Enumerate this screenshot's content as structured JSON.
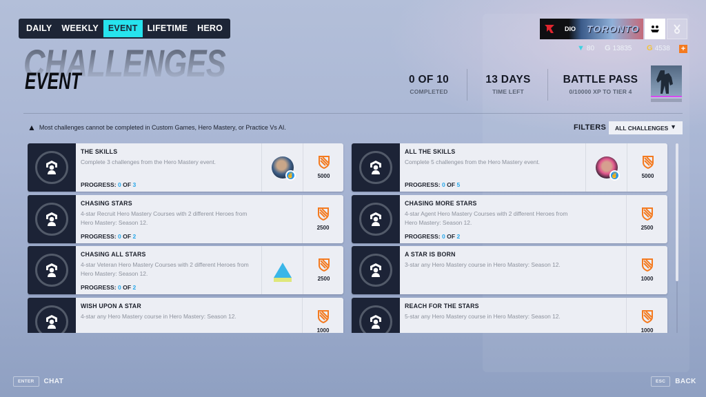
{
  "tabs": [
    {
      "label": "DAILY",
      "active": false
    },
    {
      "label": "WEEKLY",
      "active": false
    },
    {
      "label": "EVENT",
      "active": true
    },
    {
      "label": "LIFETIME",
      "active": false
    },
    {
      "label": "HERO",
      "active": false
    }
  ],
  "header": {
    "title": "CHALLENGES",
    "subtitle": "EVENT"
  },
  "player": {
    "name": "DIO",
    "banner_text": "TORONTO",
    "logo_glyph": "⊿"
  },
  "currencies": [
    {
      "icon": "legacy-credits-icon",
      "glyph": "▼",
      "value": "80",
      "color": "#3fd2e0"
    },
    {
      "icon": "competitive-points-icon",
      "glyph": "G",
      "value": "13835",
      "color": "#e8ecf3"
    },
    {
      "icon": "coins-icon",
      "glyph": "G",
      "value": "4538",
      "color": "#f3c23a"
    }
  ],
  "add_currency_label": "+",
  "stats": {
    "completed": {
      "value": "0 OF 10",
      "label": "COMPLETED"
    },
    "time_left": {
      "value": "13 DAYS",
      "label": "TIME LEFT"
    },
    "battle_pass": {
      "value": "BATTLE PASS",
      "label": "0/10000 XP TO TIER 4"
    }
  },
  "warning": "Most challenges cannot be completed in Custom Games, Hero Mastery, or Practice Vs AI.",
  "filters": {
    "label": "FILTERS",
    "selected": "ALL CHALLENGES"
  },
  "colors": {
    "accent": "#27e3ed",
    "progress_blue": "#26a7ea",
    "reward_orange": "#f47a1f",
    "card_dark": "#1c2336"
  },
  "challenges": [
    {
      "title": "THE SKILLS",
      "description": "Complete 3 challenges from the Hero Mastery event.",
      "progress_label": "PROGRESS:",
      "progress_current": "0",
      "progress_of": "OF",
      "progress_total": "3",
      "extra_reward": "hero-avatar",
      "xp": "5000"
    },
    {
      "title": "ALL THE SKILLS",
      "description": "Complete 5 challenges from the Hero Mastery event.",
      "progress_label": "PROGRESS:",
      "progress_current": "0",
      "progress_of": "OF",
      "progress_total": "5",
      "extra_reward": "hero-avatar",
      "xp": "5000"
    },
    {
      "title": "CHASING STARS",
      "description": "4-star Recruit Hero Mastery Courses with 2 different Heroes from Hero Mastery: Season 12.",
      "progress_label": "PROGRESS:",
      "progress_current": "0",
      "progress_of": "OF",
      "progress_total": "2",
      "extra_reward": null,
      "xp": "2500"
    },
    {
      "title": "CHASING MORE STARS",
      "description": "4-star Agent Hero Mastery Courses with 2 different Heroes from Hero Mastery: Season 12.",
      "progress_label": "PROGRESS:",
      "progress_current": "0",
      "progress_of": "OF",
      "progress_total": "2",
      "extra_reward": null,
      "xp": "2500"
    },
    {
      "title": "CHASING ALL STARS",
      "description": "4-star Veteran Hero Mastery Courses with 2 different Heroes from Hero Mastery: Season 12.",
      "progress_label": "PROGRESS:",
      "progress_current": "0",
      "progress_of": "OF",
      "progress_total": "2",
      "extra_reward": "spray",
      "xp": "2500"
    },
    {
      "title": "A STAR IS BORN",
      "description": "3-star any Hero Mastery course in Hero Mastery: Season 12.",
      "progress_label": null,
      "xp": "1000"
    },
    {
      "title": "WISH UPON A STAR",
      "description": "4-star any Hero Mastery course in Hero Mastery: Season 12.",
      "progress_label": null,
      "xp": "1000"
    },
    {
      "title": "REACH FOR THE STARS",
      "description": "5-star any Hero Mastery course in Hero Mastery: Season 12.",
      "progress_label": null,
      "xp": "1000"
    }
  ],
  "footer": {
    "chat": {
      "key": "ENTER",
      "label": "CHAT"
    },
    "back": {
      "key": "ESC",
      "label": "BACK"
    }
  }
}
